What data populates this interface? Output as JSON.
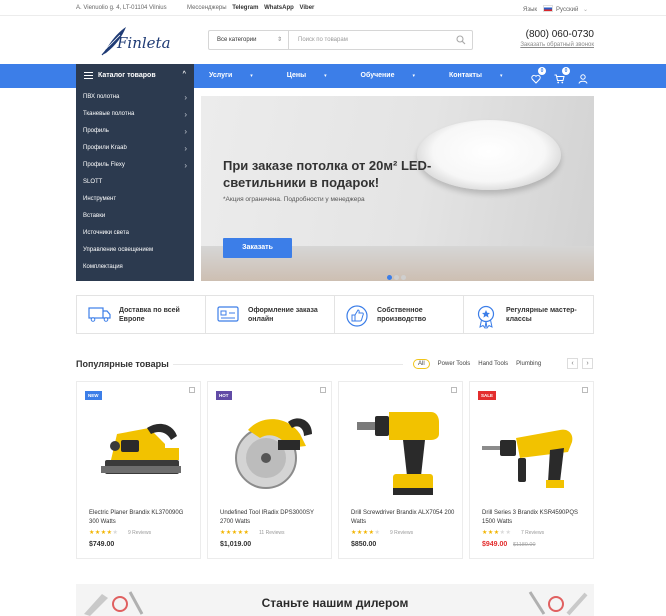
{
  "topbar": {
    "address": "А. Vienuolio g. 4, LT-01104 Vilnius",
    "messengers_label": "Мессенджеры",
    "messengers": [
      "Telegram",
      "WhatsApp",
      "Viber"
    ],
    "language_label": "Язык",
    "language_value": "Русский"
  },
  "header": {
    "logo_text": "Finleta",
    "search_category": "Все категории",
    "search_placeholder": "Поиск по товарам",
    "phone": "(800) 060-0730",
    "callback": "Заказать обратный звонок"
  },
  "nav": {
    "catalog_label": "Каталог товаров",
    "links": [
      "Услуги",
      "Цены",
      "Обучение",
      "Контакты"
    ],
    "wishlist_count": "0",
    "cart_count": "0"
  },
  "sidebar": {
    "items": [
      {
        "label": "ПВХ полотна",
        "arrow": true
      },
      {
        "label": "Тканевые полотна",
        "arrow": true
      },
      {
        "label": "Профиль",
        "arrow": true
      },
      {
        "label": "Профили Kraab",
        "arrow": true
      },
      {
        "label": "Профиль Flexy",
        "arrow": true
      },
      {
        "label": "SLOTT",
        "arrow": false
      },
      {
        "label": "Инструмент",
        "arrow": false
      },
      {
        "label": "Вставки",
        "arrow": false
      },
      {
        "label": "Источники света",
        "arrow": false
      },
      {
        "label": "Управление освещением",
        "arrow": false
      },
      {
        "label": "Комплектация",
        "arrow": false
      }
    ]
  },
  "hero": {
    "title": "При заказе потолка от 20м² LED-светильники в подарок!",
    "subtitle": "*Акция ограничена. Подробности у менеджера",
    "button": "Заказать",
    "slides": 3,
    "active_slide": 1
  },
  "features": [
    {
      "label": "Доставка по всей Европе",
      "icon": "truck-icon"
    },
    {
      "label": "Оформление заказа онлайн",
      "icon": "card-icon"
    },
    {
      "label": "Собственное производство",
      "icon": "thumbs-up-icon"
    },
    {
      "label": "Регулярные мастер-классы",
      "icon": "award-icon"
    }
  ],
  "popular": {
    "title": "Популярные товары",
    "tabs": [
      "All",
      "Power Tools",
      "Hand Tools",
      "Plumbing"
    ],
    "active_tab": "All",
    "prev": "‹",
    "next": "›"
  },
  "products": [
    {
      "name": "Electric Planer Brandix KL370090G 300 Watts",
      "tag": "NEW",
      "tag_color": "#3c7ee8",
      "rating": 4,
      "reviews": "9 Reviews",
      "price": "$749.00",
      "old_price": "",
      "sale": false
    },
    {
      "name": "Undefined Tool IRadix DPS3000SY 2700 Watts",
      "tag": "HOT",
      "tag_color": "#614ba6",
      "rating": 5,
      "reviews": "11 Reviews",
      "price": "$1,019.00",
      "old_price": "",
      "sale": false
    },
    {
      "name": "Drill Screwdriver Brandix ALX7054 200 Watts",
      "tag": "",
      "tag_color": "",
      "rating": 4,
      "reviews": "9 Reviews",
      "price": "$850.00",
      "old_price": "",
      "sale": false
    },
    {
      "name": "Drill Series 3 Brandix KSR4590PQS 1500 Watts",
      "tag": "SALE",
      "tag_color": "#e32d2d",
      "rating": 3,
      "reviews": "7 Reviews",
      "price": "$949.00",
      "old_price": "$1189.00",
      "sale": true
    }
  ],
  "dealer": {
    "title": "Станьте нашим дилером"
  },
  "colors": {
    "accent": "#3c7ee8",
    "sidebar": "#2c3a4f",
    "tool_yellow": "#f2c200",
    "sale": "#e32d2d"
  }
}
